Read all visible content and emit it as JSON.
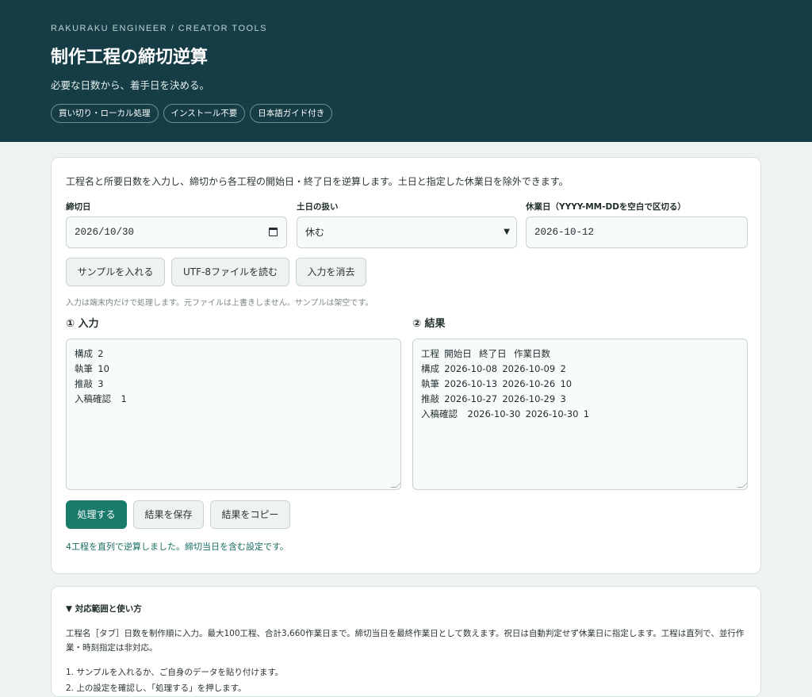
{
  "header": {
    "eyebrow": "RAKURAKU ENGINEER / CREATOR TOOLS",
    "title": "制作工程の締切逆算",
    "subtitle": "必要な日数から、着手日を決める。",
    "tags": [
      "買い切り・ローカル処理",
      "インストール不要",
      "日本語ガイド付き"
    ]
  },
  "form": {
    "intro": "工程名と所要日数を入力し、締切から各工程の開始日・終了日を逆算します。土日と指定した休業日を除外できます。",
    "deadline_label": "締切日",
    "deadline_value": "2026/10/30",
    "weekend_label": "土日の扱い",
    "weekend_value": "休む",
    "holidays_label": "休業日（YYYY-MM-DDを空白で区切る）",
    "holidays_value": "2026-10-12",
    "buttons": {
      "sample": "サンプルを入れる",
      "load_file": "UTF-8ファイルを読む",
      "clear": "入力を消去"
    },
    "note": "入力は端末内だけで処理します。元ファイルは上書きしません。サンプルは架空です。"
  },
  "input_section": {
    "heading": "① 入力",
    "text": "構成\t2\n執筆\t10\n推敲\t3\n入稿確認\t1"
  },
  "result_section": {
    "heading": "② 結果",
    "text": "工程\t開始日\t終了日\t作業日数\n構成\t2026-10-08\t2026-10-09\t2\n執筆\t2026-10-13\t2026-10-26\t10\n推敲\t2026-10-27\t2026-10-29\t3\n入稿確認\t2026-10-30\t2026-10-30\t1"
  },
  "actions": {
    "process": "処理する",
    "save": "結果を保存",
    "copy": "結果をコピー"
  },
  "status": "4工程を直列で逆算しました。締切当日を含む設定です。",
  "help": {
    "summary": "▼ 対応範囲と使い方",
    "body": "工程名［タブ］日数を制作順に入力。最大100工程、合計3,660作業日まで。締切当日を最終作業日として数えます。祝日は自動判定せず休業日に指定します。工程は直列で、並行作業・時刻指定は非対応。",
    "steps": [
      "1. サンプルを入れるか、ご自身のデータを貼り付けます。",
      "2. 上の設定を確認し、「処理する」を押します。"
    ]
  }
}
